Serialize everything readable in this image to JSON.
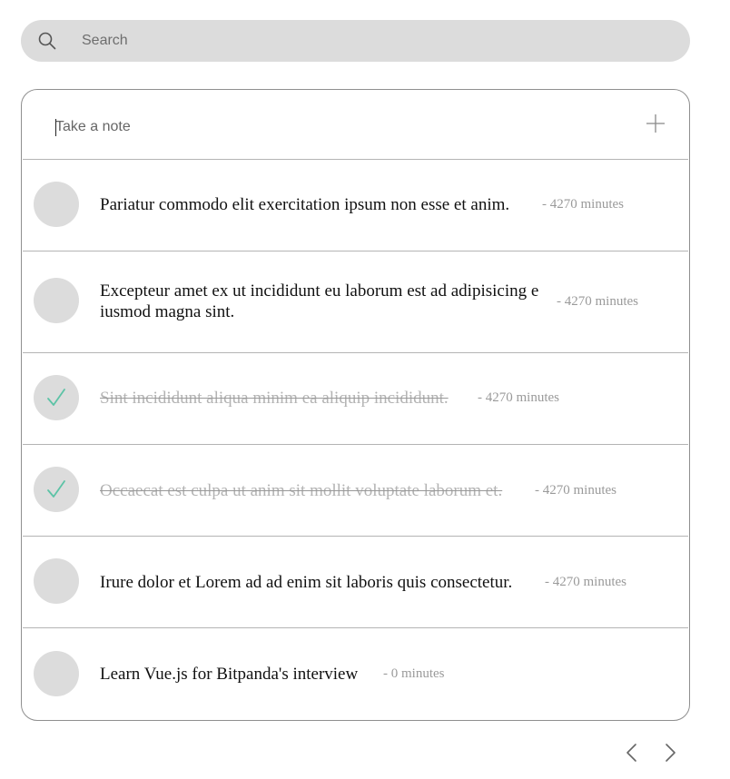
{
  "search": {
    "placeholder": "Search",
    "icon": "search-icon"
  },
  "new_note": {
    "placeholder": "Take a note",
    "add_icon": "plus-icon"
  },
  "todos": [
    {
      "text": "Pariatur commodo elit exercitation ipsum non esse et anim.",
      "time": "- 4270 minutes",
      "done": false
    },
    {
      "text": "Excepteur amet ex ut incididunt eu laborum est ad adipisicing eiusmod magna sint.",
      "time": "- 4270 minutes",
      "done": false
    },
    {
      "text": "Sint incididunt aliqua minim ea aliquip incididunt.",
      "time": "- 4270 minutes",
      "done": true
    },
    {
      "text": "Occaecat est culpa ut anim sit mollit voluptate laborum et.",
      "time": "- 4270 minutes",
      "done": true
    },
    {
      "text": "Irure dolor et Lorem ad ad enim sit laboris quis consectetur.",
      "time": "- 4270 minutes",
      "done": false
    },
    {
      "text": "Learn Vue.js for Bitpanda's interview",
      "time": "- 0 minutes",
      "done": false
    }
  ],
  "pagination": {
    "prev_icon": "chevron-left-icon",
    "next_icon": "chevron-right-icon"
  },
  "colors": {
    "check": "#5cc3a6",
    "circle": "#dcdcdc",
    "search_bg": "#dcdcdc",
    "done_text": "#b3b3b3"
  }
}
